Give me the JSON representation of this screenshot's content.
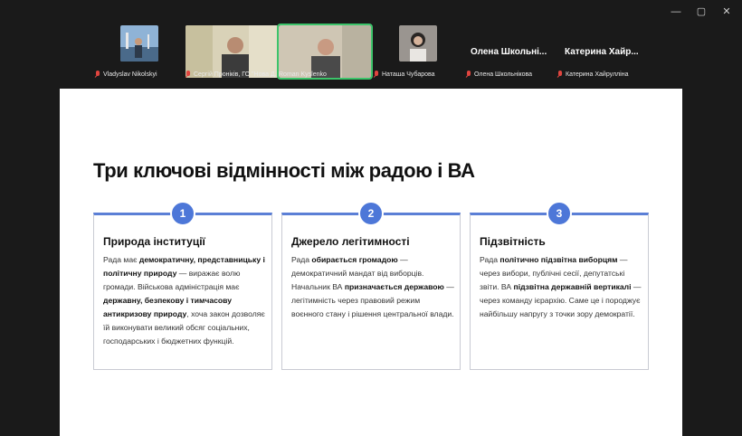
{
  "window": {
    "controls": [
      "—",
      "▢",
      "✕"
    ]
  },
  "participants": [
    {
      "name": "Vladyslav Nikolskyi",
      "muted": true,
      "type": "video"
    },
    {
      "name": "Сергій Проніків, ГО \"Нова Д...",
      "muted": true,
      "type": "video"
    },
    {
      "name": "Roman Kyslenko",
      "muted": false,
      "type": "video",
      "active_speaker": true
    },
    {
      "name": "Наташа Чубарова",
      "muted": true,
      "type": "video"
    },
    {
      "name": "Олена Школьнікова",
      "display_name": "Олена  Школьні...",
      "muted": true,
      "type": "text"
    },
    {
      "name": "Катерина Хайрулліна",
      "display_name": "Катерина  Хайр...",
      "muted": true,
      "type": "text"
    }
  ],
  "slide": {
    "title": "Три ключові відмінності між радою і ВА",
    "cards": [
      {
        "number": "1",
        "title": "Природа інституції",
        "body": [
          {
            "t": "Рада має ",
            "b": false
          },
          {
            "t": "демократичну, представницьку і політичну природу",
            "b": true
          },
          {
            "t": " — виражає волю громади. Військова адміністрація має ",
            "b": false
          },
          {
            "t": "державну, безпекову і тимчасову антикризову природу",
            "b": true
          },
          {
            "t": ", хоча закон дозволяє їй виконувати великий обсяг соціальних, господарських і бюджетних функцій.",
            "b": false
          }
        ]
      },
      {
        "number": "2",
        "title": "Джерело легітимності",
        "body": [
          {
            "t": "Рада ",
            "b": false
          },
          {
            "t": "обирається громадою",
            "b": true
          },
          {
            "t": " — демократичний мандат від виборців. Начальник ВА ",
            "b": false
          },
          {
            "t": "призначається державою",
            "b": true
          },
          {
            "t": " — легітимність через правовий режим воєнного стану і рішення центральної влади.",
            "b": false
          }
        ]
      },
      {
        "number": "3",
        "title": "Підзвітність",
        "body": [
          {
            "t": "Рада ",
            "b": false
          },
          {
            "t": "політично підзвітна виборцям",
            "b": true
          },
          {
            "t": " — через вибори, публічні сесії, депутатські звіти. ВА ",
            "b": false
          },
          {
            "t": "підзвітна державній вертикалі",
            "b": true
          },
          {
            "t": " — через команду ієрархію. Саме це і породжує найбільшу напругу з точки зору демократії.",
            "b": false
          }
        ]
      }
    ]
  }
}
